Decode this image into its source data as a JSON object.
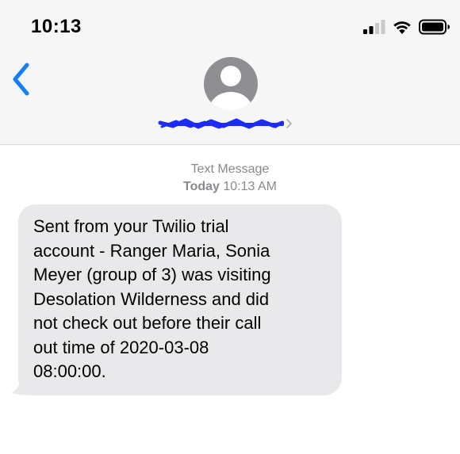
{
  "status_bar": {
    "time": "10:13",
    "icons": [
      "cellular-signal-icon",
      "wifi-icon",
      "battery-icon"
    ]
  },
  "nav": {
    "back_icon": "chevron-left-icon",
    "avatar_icon": "person-avatar-icon",
    "contact_detail_icon": "chevron-right-icon"
  },
  "thread": {
    "meta_line1": "Text Message",
    "meta_day": "Today",
    "meta_time": " 10:13 AM",
    "message": "Sent from your Twilio trial\naccount - Ranger Maria, Sonia\nMeyer (group of 3) was visiting\nDesolation Wilderness and did\nnot check out before their call\nout time of 2020-03-08\n08:00:00."
  },
  "colors": {
    "accent": "#147efb",
    "header_bg": "#f6f6f6",
    "bubble_bg": "#e9e9eb",
    "meta_text": "#8a8a8e",
    "avatar": "#8e8e93",
    "redaction": "#1a2bff"
  }
}
